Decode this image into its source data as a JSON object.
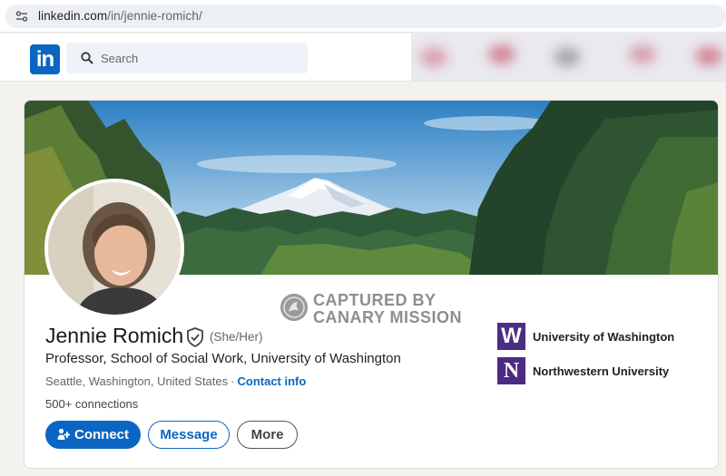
{
  "browser": {
    "url_host": "linkedin.com",
    "url_path": "/in/jennie-romich/"
  },
  "nav": {
    "logo_text": "in",
    "search_placeholder": "Search"
  },
  "watermark": {
    "line1": "CAPTURED BY",
    "line2": "CANARY MISSION"
  },
  "profile": {
    "name": "Jennie Romich",
    "pronouns": "(She/Her)",
    "headline": "Professor, School of Social Work, University of Washington",
    "location": "Seattle, Washington, United States",
    "separator": "·",
    "contact_info": "Contact info",
    "connections": "500+ connections"
  },
  "actions": {
    "connect": "Connect",
    "message": "Message",
    "more": "More"
  },
  "education": [
    {
      "logo": "W",
      "name": "University of Washington",
      "color": "#4b2e83"
    },
    {
      "logo": "N",
      "name": "Northwestern University",
      "color": "#4e2a84"
    }
  ],
  "colors": {
    "brand": "#0a66c2",
    "page_bg": "#f4f2ee"
  },
  "icons": [
    "tune-icon",
    "linkedin-logo",
    "search-icon",
    "verified-icon",
    "add-person-icon",
    "canary-mission-icon"
  ]
}
